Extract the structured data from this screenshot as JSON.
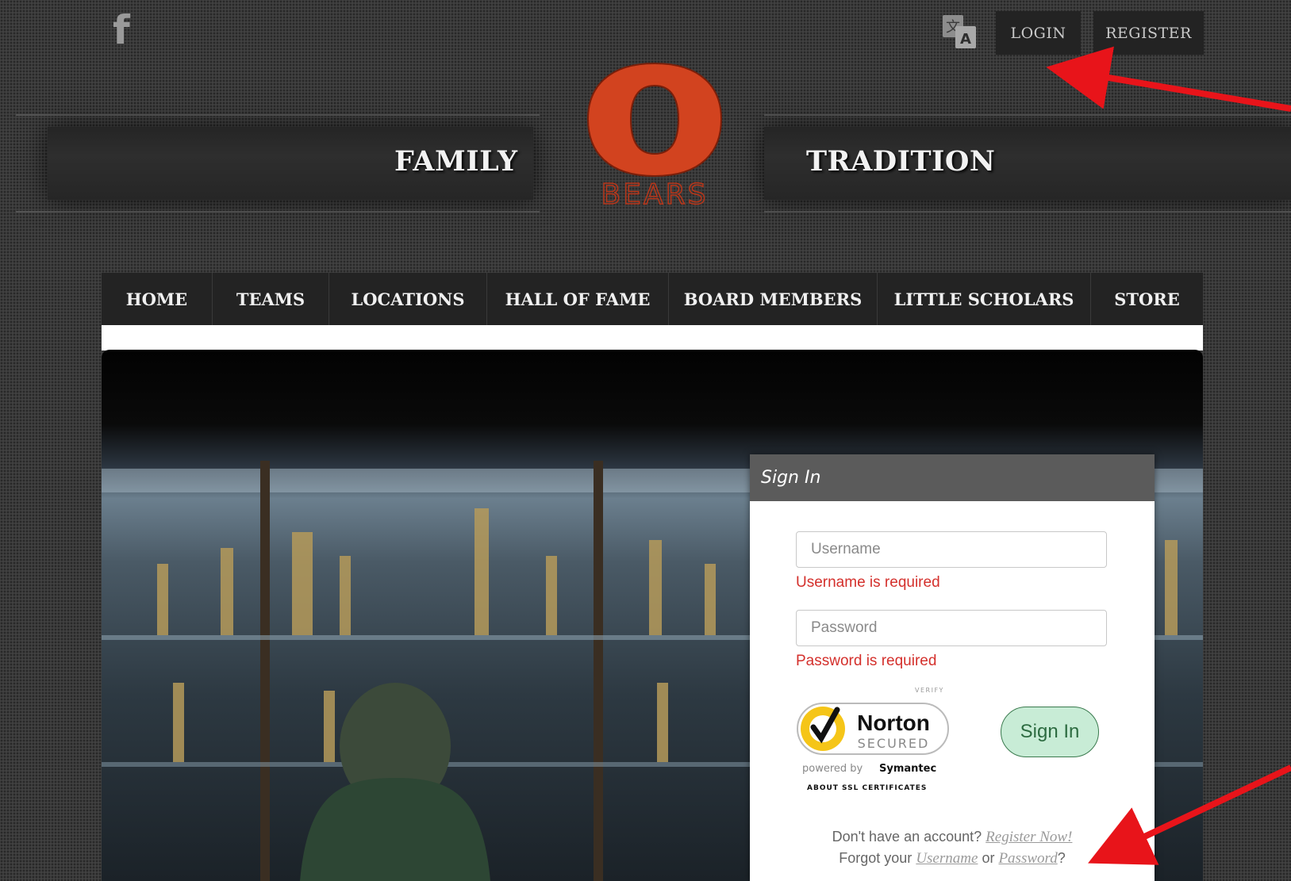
{
  "topbar": {
    "facebook_icon": "facebook-icon",
    "translate_icon": "translate-icon",
    "login_label": "LOGIN",
    "register_label": "REGISTER"
  },
  "banner": {
    "left_word": "FAMILY",
    "right_word": "TRADITION",
    "logo_letter": "O",
    "logo_text": "BEARS"
  },
  "nav": {
    "items": [
      {
        "label": "HOME"
      },
      {
        "label": "TEAMS"
      },
      {
        "label": "LOCATIONS"
      },
      {
        "label": "HALL OF FAME"
      },
      {
        "label": "BOARD MEMBERS"
      },
      {
        "label": "LITTLE SCHOLARS"
      },
      {
        "label": "STORE"
      }
    ]
  },
  "signin": {
    "title": "Sign In",
    "username_placeholder": "Username",
    "username_value": "",
    "username_error": "Username is required",
    "password_placeholder": "Password",
    "password_value": "",
    "password_error": "Password is required",
    "button_label": "Sign In",
    "norton": {
      "verify": "VERIFY",
      "brand": "Norton",
      "secured": "SECURED",
      "powered_by": "powered by",
      "symantec": "Symantec",
      "about": "ABOUT SSL CERTIFICATES"
    },
    "no_account_text": "Don't have an account?",
    "register_link": "Register Now!",
    "forgot_prefix": "Forgot your",
    "forgot_username_link": "Username",
    "forgot_or": "or",
    "forgot_password_link": "Password",
    "forgot_suffix": "?"
  },
  "colors": {
    "logo_orange": "#d2431f",
    "annotation_red": "#e8141a",
    "error_red": "#d4302c"
  }
}
